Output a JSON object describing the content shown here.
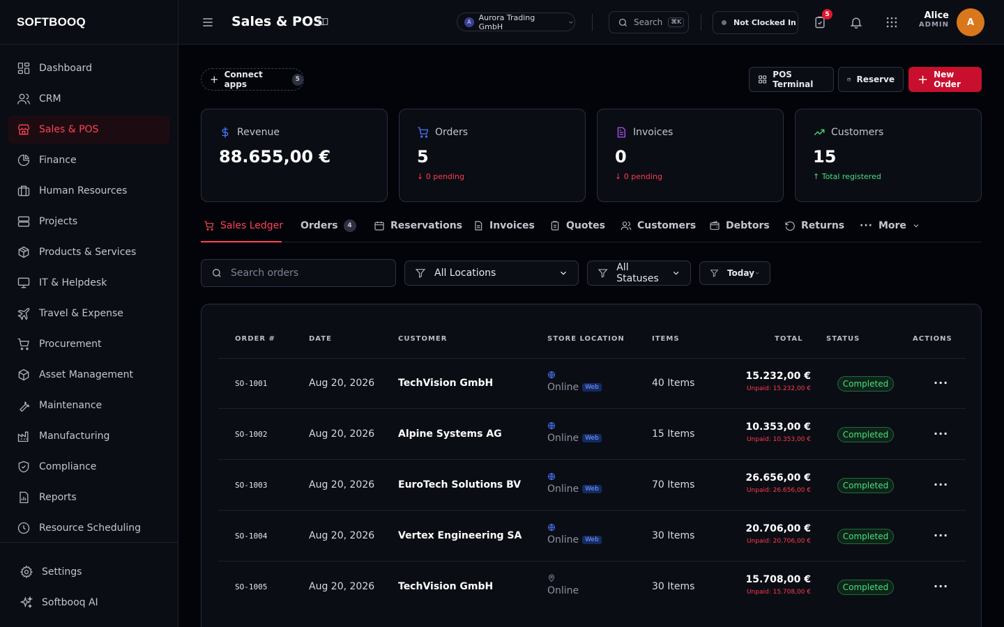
{
  "app": {
    "logo": "SOFTBOOQ"
  },
  "sidebar": {
    "items": [
      {
        "label": "Dashboard",
        "icon": "dashboard-grid-icon"
      },
      {
        "label": "CRM",
        "icon": "users-icon"
      },
      {
        "label": "Sales & POS",
        "icon": "store-icon",
        "active": true
      },
      {
        "label": "Finance",
        "icon": "pie-chart-icon"
      },
      {
        "label": "Human Resources",
        "icon": "briefcase-icon"
      },
      {
        "label": "Projects",
        "icon": "server-stack-icon"
      },
      {
        "label": "Products & Services",
        "icon": "package-icon"
      },
      {
        "label": "IT & Helpdesk",
        "icon": "monitor-icon"
      },
      {
        "label": "Travel & Expense",
        "icon": "plane-icon"
      },
      {
        "label": "Procurement",
        "icon": "cart-icon"
      },
      {
        "label": "Asset Management",
        "icon": "box-icon"
      },
      {
        "label": "Maintenance",
        "icon": "wrench-icon"
      },
      {
        "label": "Manufacturing",
        "icon": "factory-icon"
      },
      {
        "label": "Compliance",
        "icon": "shield-check-icon"
      },
      {
        "label": "Reports",
        "icon": "report-icon"
      },
      {
        "label": "Resource Scheduling",
        "icon": "clock-icon"
      }
    ],
    "bottom": [
      {
        "label": "Settings",
        "icon": "gear-icon"
      },
      {
        "label": "Softbooq AI",
        "icon": "sparkles-icon"
      }
    ]
  },
  "header": {
    "title": "Sales & POS",
    "org": {
      "initial": "A",
      "name": "Aurora Trading GmbH"
    },
    "search": {
      "label": "Search",
      "shortcut": "⌘K"
    },
    "clock_status": "Not Clocked In",
    "tasks_badge": "5",
    "user": {
      "name": "Alice",
      "role": "ADMIN",
      "initial": "A"
    }
  },
  "toolbar": {
    "connect_label": "Connect apps",
    "connect_count": "5",
    "pos_terminal": "POS Terminal",
    "reserve": "Reserve",
    "new_order": "New Order"
  },
  "stats": [
    {
      "label": "Revenue",
      "value": "88.655,00 €",
      "sub": "",
      "icon": "dollar-icon",
      "color": "#4b79ff"
    },
    {
      "label": "Orders",
      "value": "5",
      "sub": "↓ 0 pending",
      "icon": "cart-icon",
      "color": "#4b79ff",
      "sub_color": "#ff3b4e"
    },
    {
      "label": "Invoices",
      "value": "0",
      "sub": "↓ 0 pending",
      "icon": "document-icon",
      "color": "#a855f7",
      "sub_color": "#ff3b4e"
    },
    {
      "label": "Customers",
      "value": "15",
      "sub": "↑ Total registered",
      "icon": "trending-up-icon",
      "color": "#4ade80",
      "sub_color": "#4ade80"
    }
  ],
  "tabs": [
    {
      "label": "Sales Ledger",
      "active": true
    },
    {
      "label": "Orders",
      "badge": "4"
    },
    {
      "label": "Reservations"
    },
    {
      "label": "Invoices"
    },
    {
      "label": "Quotes"
    },
    {
      "label": "Customers"
    },
    {
      "label": "Debtors"
    },
    {
      "label": "Returns"
    },
    {
      "label": "More"
    }
  ],
  "filters": {
    "search_placeholder": "Search orders",
    "location": "All Locations",
    "status": "All Statuses",
    "date": "Today"
  },
  "table": {
    "columns": [
      "ORDER #",
      "DATE",
      "CUSTOMER",
      "STORE LOCATION",
      "ITEMS",
      "TOTAL",
      "STATUS",
      "ACTIONS"
    ],
    "rows": [
      {
        "order": "SO-1001",
        "date": "Aug 20, 2026",
        "customer": "TechVision GmbH",
        "location": "Online",
        "tag": "Web",
        "items": "40 Items",
        "total": "15.232,00 €",
        "unpaid": "Unpaid: 15.232,00 €",
        "status": "Completed"
      },
      {
        "order": "SO-1002",
        "date": "Aug 20, 2026",
        "customer": "Alpine Systems AG",
        "location": "Online",
        "tag": "Web",
        "items": "15 Items",
        "total": "10.353,00 €",
        "unpaid": "Unpaid: 10.353,00 €",
        "status": "Completed"
      },
      {
        "order": "SO-1003",
        "date": "Aug 20, 2026",
        "customer": "EuroTech Solutions BV",
        "location": "Online",
        "tag": "Web",
        "items": "70 Items",
        "total": "26.656,00 €",
        "unpaid": "Unpaid: 26.656,00 €",
        "status": "Completed"
      },
      {
        "order": "SO-1004",
        "date": "Aug 20, 2026",
        "customer": "Vertex Engineering SA",
        "location": "Online",
        "tag": "Web",
        "items": "30 Items",
        "total": "20.706,00 €",
        "unpaid": "Unpaid: 20.706,00 €",
        "status": "Completed"
      },
      {
        "order": "SO-1005",
        "date": "Aug 20, 2026",
        "customer": "TechVision GmbH",
        "location": "Online",
        "tag": "",
        "items": "30 Items",
        "total": "15.708,00 €",
        "unpaid": "Unpaid: 15.708,00 €",
        "status": "Completed"
      }
    ]
  },
  "colors": {
    "accent": "#ff4256",
    "primary_button": "#c8102e",
    "success": "#4ade80",
    "link_blue": "#4b79ff"
  }
}
